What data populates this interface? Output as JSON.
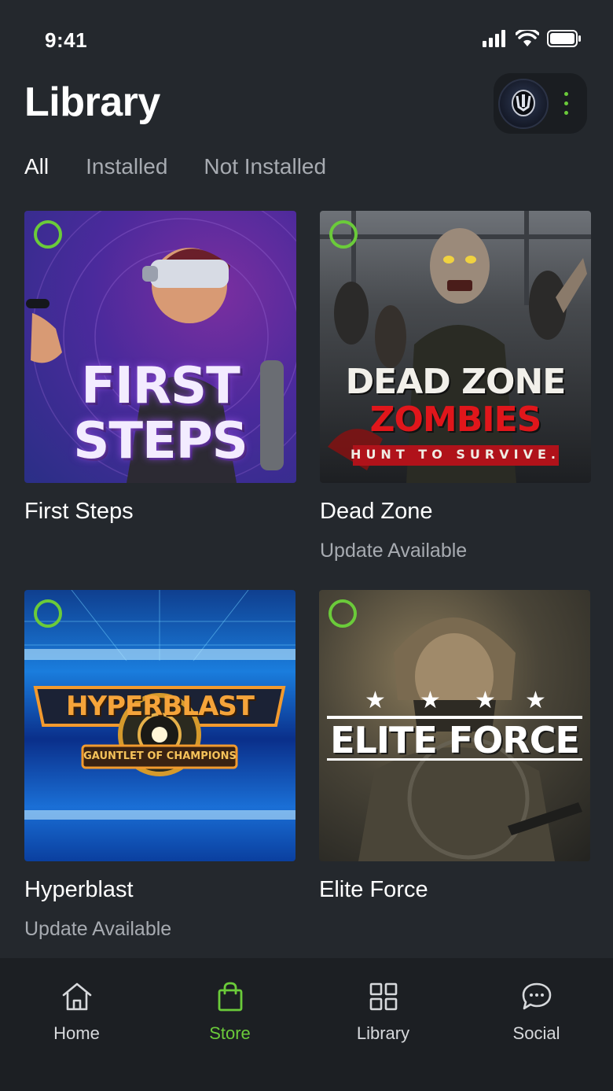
{
  "status": {
    "time": "9:41"
  },
  "header": {
    "title": "Library"
  },
  "filters": [
    {
      "label": "All",
      "active": true
    },
    {
      "label": "Installed",
      "active": false
    },
    {
      "label": "Not Installed",
      "active": false
    }
  ],
  "games": [
    {
      "title": "First Steps",
      "subtitle": "",
      "art_lines": [
        "FIRST",
        "STEPS"
      ]
    },
    {
      "title": "Dead Zone",
      "subtitle": "Update Available",
      "art_lines": [
        "DEAD ZONE",
        "ZOMBIES",
        "HUNT TO SURVIVE."
      ]
    },
    {
      "title": "Hyperblast",
      "subtitle": "Update Available",
      "art_lines": [
        "HYPERBLAST",
        "GAUNTLET OF CHAMPIONS"
      ]
    },
    {
      "title": "Elite Force",
      "subtitle": "",
      "art_lines": [
        "ELITE FORCE"
      ]
    }
  ],
  "tabbar": [
    {
      "label": "Home",
      "icon": "home-icon",
      "active": false
    },
    {
      "label": "Store",
      "icon": "shopping-bag-icon",
      "active": true
    },
    {
      "label": "Library",
      "icon": "grid-icon",
      "active": false
    },
    {
      "label": "Social",
      "icon": "chat-bubble-icon",
      "active": false
    }
  ],
  "colors": {
    "accent": "#6bcb3a",
    "background": "#24282d",
    "tabbar": "#1c1f23"
  }
}
